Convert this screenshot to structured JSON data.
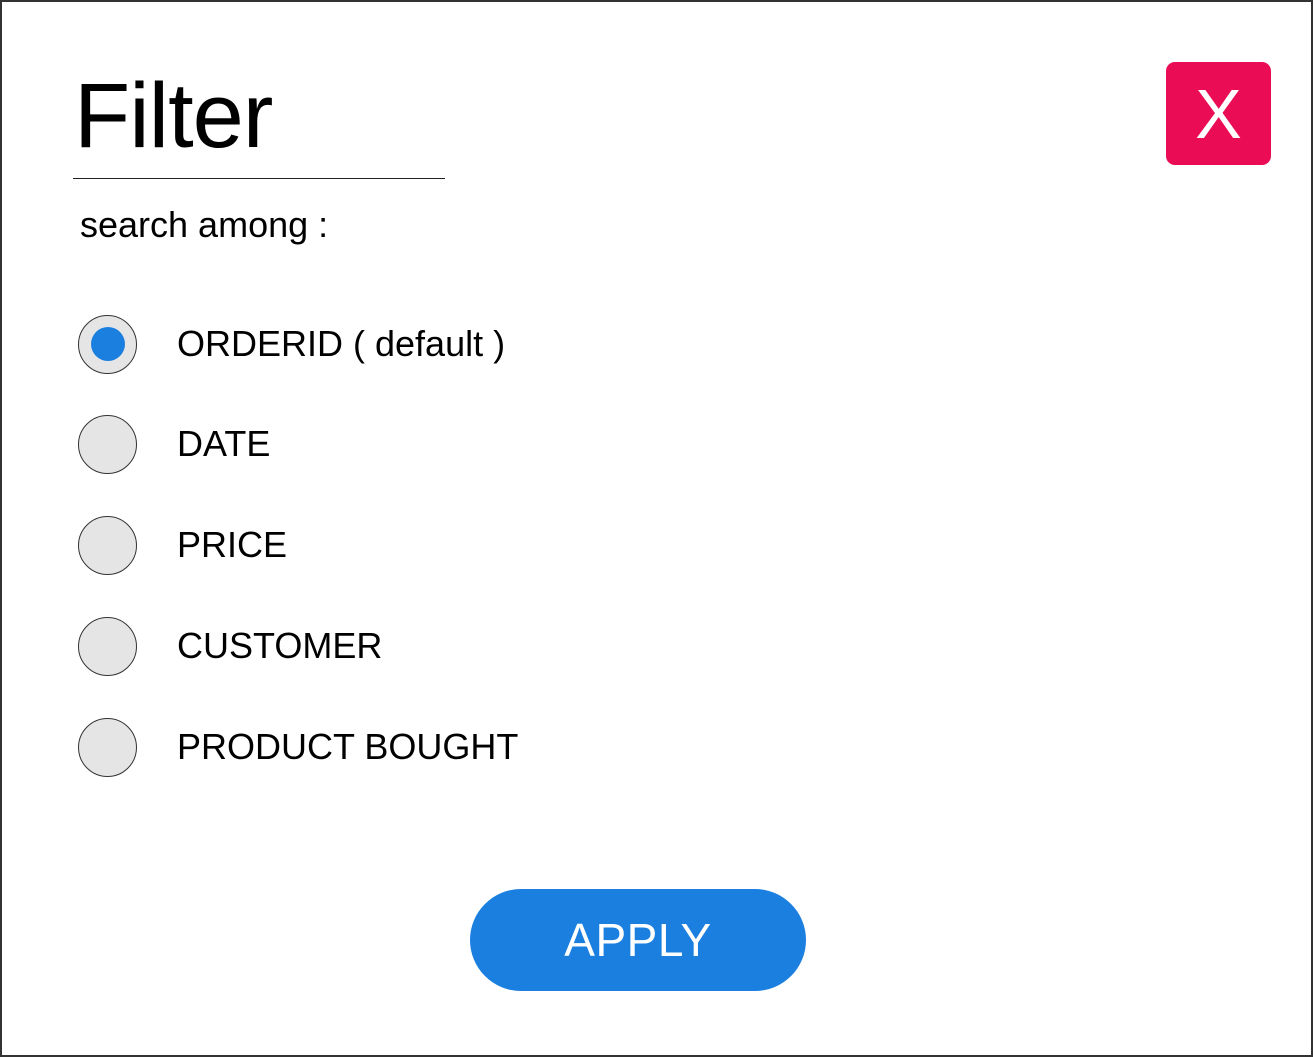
{
  "dialog": {
    "title": "Filter",
    "close_label": "X",
    "subtitle": "search among :",
    "apply_label": "APPLY"
  },
  "options": [
    {
      "label": "ORDERID ( default )",
      "selected": true
    },
    {
      "label": "DATE",
      "selected": false
    },
    {
      "label": "PRICE",
      "selected": false
    },
    {
      "label": "CUSTOMER",
      "selected": false
    },
    {
      "label": "PRODUCT BOUGHT",
      "selected": false
    }
  ],
  "colors": {
    "close": "#ea0c55",
    "accent": "#1b7fe0",
    "radio_bg": "#e5e5e5"
  },
  "icons": {
    "close": "close-icon",
    "radio_selected": "radio-selected-icon",
    "radio_unselected": "radio-unselected-icon"
  }
}
